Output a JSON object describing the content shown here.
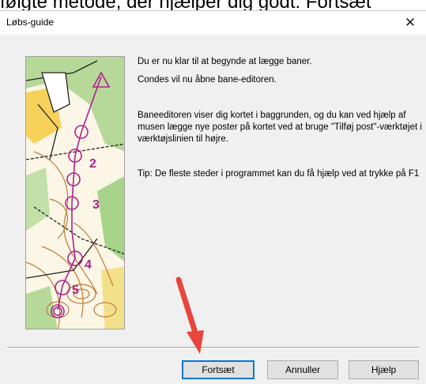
{
  "background_text": "følgte metode, der hjælper dig godt: Fortsæt",
  "window": {
    "title": "Løbs-guide",
    "close_glyph": "✕"
  },
  "content": {
    "paragraphs": [
      "Du er nu klar til at begynde at lægge baner.",
      "Condes vil nu åbne bane-editoren.",
      "Baneeditoren viser dig kortet i baggrunden, og du kan ved hjælp af musen lægge nye poster på kortet ved at bruge \"Tilføj post\"-værktøjet i værktøjslinien til højre.",
      "Tip:  De fleste steder i programmet kan du få hjælp ved at trykke på F1"
    ]
  },
  "map_labels": [
    "2",
    "3",
    "4",
    "5"
  ],
  "buttons": {
    "continue": "Fortsæt",
    "cancel": "Annuller",
    "help": "Hjælp"
  },
  "colors": {
    "course": "#b0208f",
    "primary_border": "#0078d7",
    "arrow": "#e8453c"
  },
  "icons": {
    "close": "close-icon",
    "arrow": "red-arrow-icon"
  }
}
